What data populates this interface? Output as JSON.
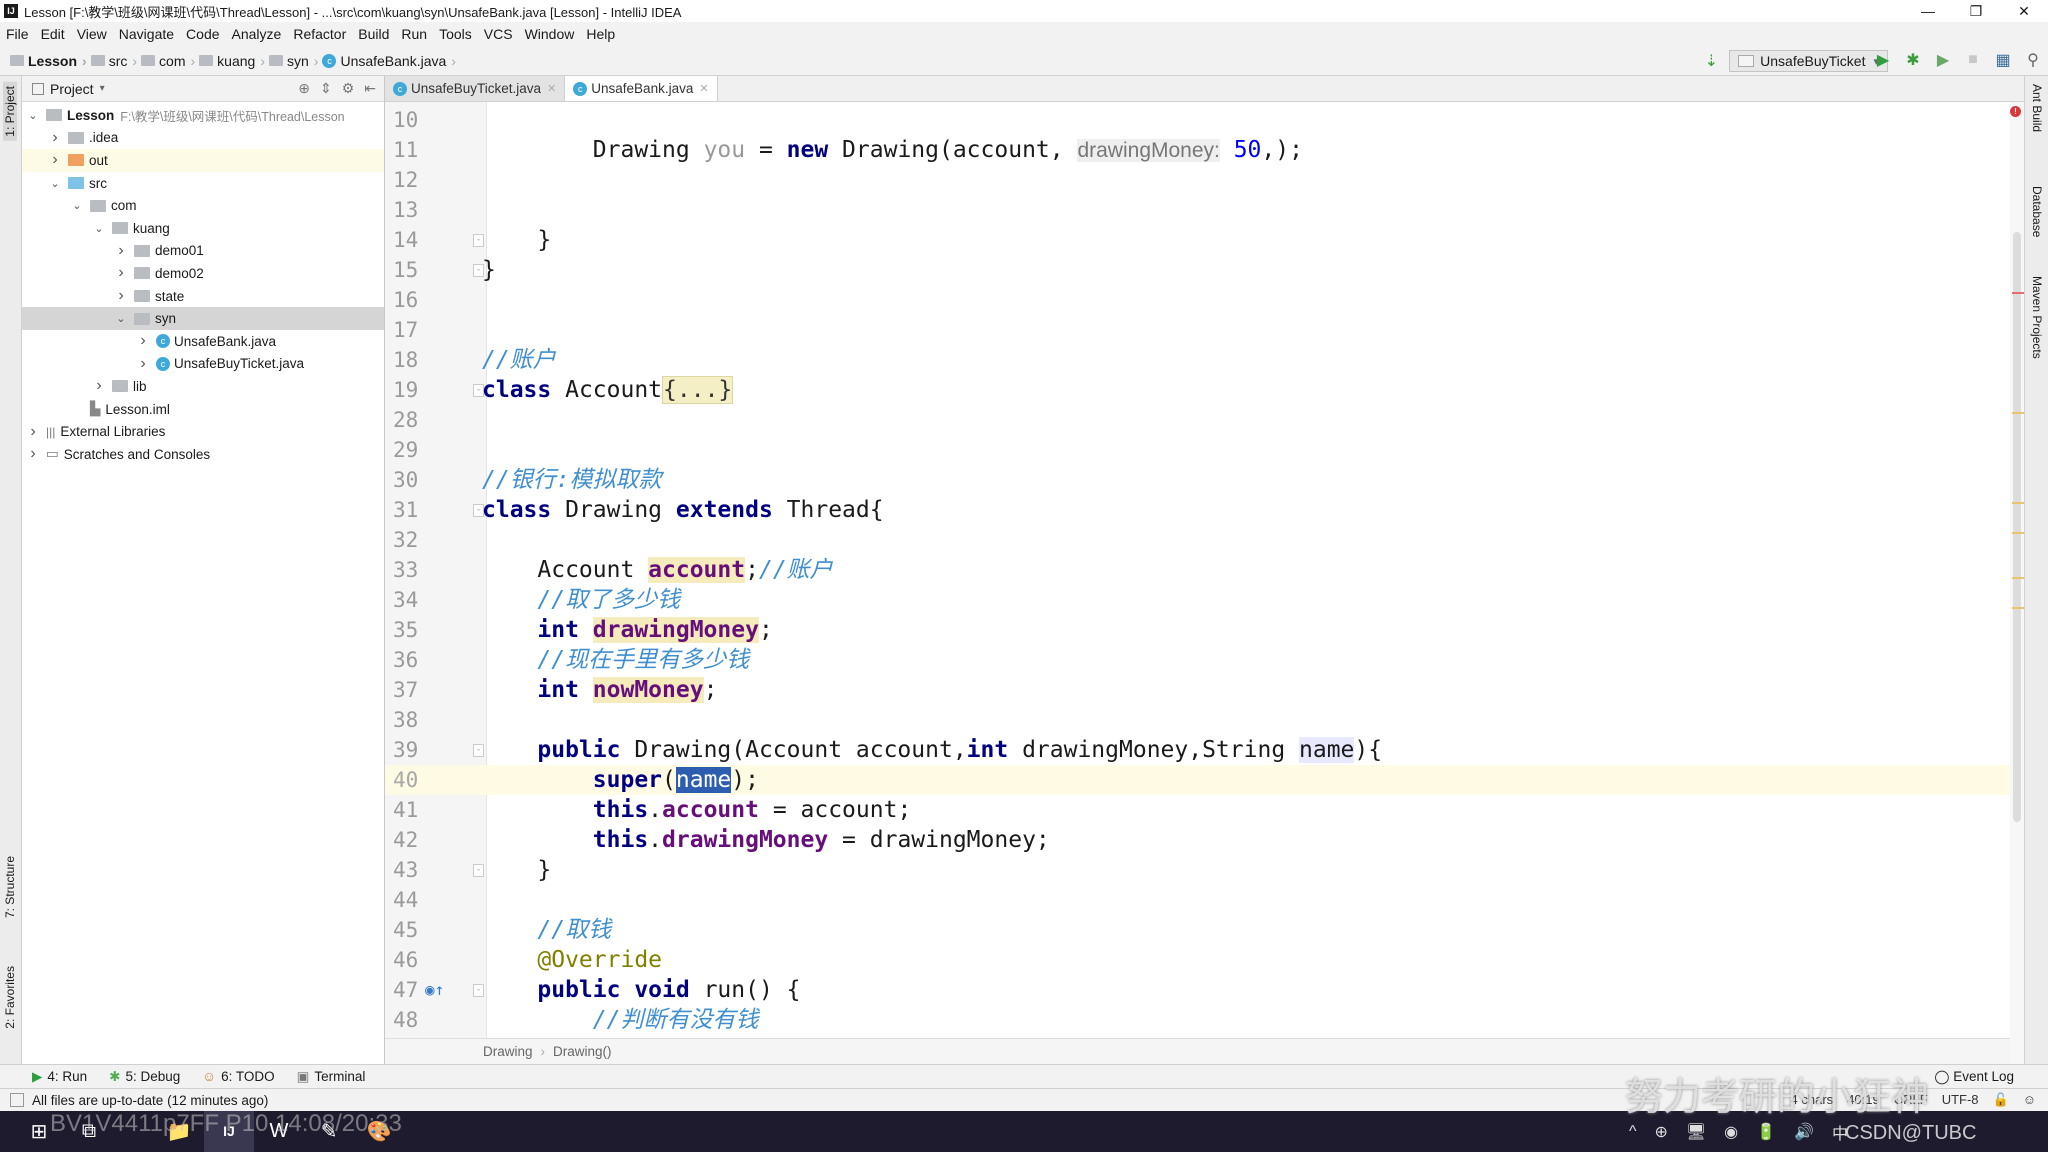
{
  "window": {
    "title": "Lesson [F:\\教学\\班级\\网课班\\代码\\Thread\\Lesson] - ...\\src\\com\\kuang\\syn\\UnsafeBank.java [Lesson] - IntelliJ IDEA",
    "logo": "IJ",
    "minimize": "—",
    "restore": "❐",
    "close": "✕"
  },
  "menu": [
    "File",
    "Edit",
    "View",
    "Navigate",
    "Code",
    "Analyze",
    "Refactor",
    "Build",
    "Run",
    "Tools",
    "VCS",
    "Window",
    "Help"
  ],
  "breadcrumb": [
    "Lesson",
    "src",
    "com",
    "kuang",
    "syn",
    "UnsafeBank.java"
  ],
  "toolbar": {
    "run_config": "UnsafeBuyTicket",
    "run_icon": "▶",
    "debug_icon": "✱",
    "coverage_icon": "▶",
    "stop_icon": "■",
    "structure_icon": "▦",
    "search_icon": "⚲",
    "sort_icon": "⇣"
  },
  "left_strip": {
    "project": "1: Project",
    "structure": "7: Structure",
    "favorites": "2: Favorites"
  },
  "right_strip": {
    "ant": "Ant Build",
    "database": "Database",
    "maven": "Maven Projects"
  },
  "project": {
    "header": "Project",
    "items": [
      {
        "label": "Lesson",
        "path": "F:\\教学\\班级\\网课班\\代码\\Thread\\Lesson",
        "depth": 0,
        "arrow": "open",
        "icon": "module",
        "bold": true
      },
      {
        "label": ".idea",
        "depth": 1,
        "arrow": "closed",
        "icon": "folder"
      },
      {
        "label": "out",
        "depth": 1,
        "arrow": "closed",
        "icon": "folder-out",
        "state": "hl"
      },
      {
        "label": "src",
        "depth": 1,
        "arrow": "open",
        "icon": "folder-src"
      },
      {
        "label": "com",
        "depth": 2,
        "arrow": "open",
        "icon": "folder"
      },
      {
        "label": "kuang",
        "depth": 3,
        "arrow": "open",
        "icon": "folder"
      },
      {
        "label": "demo01",
        "depth": 4,
        "arrow": "closed",
        "icon": "folder"
      },
      {
        "label": "demo02",
        "depth": 4,
        "arrow": "closed",
        "icon": "folder"
      },
      {
        "label": "state",
        "depth": 4,
        "arrow": "closed",
        "icon": "folder"
      },
      {
        "label": "syn",
        "depth": 4,
        "arrow": "open",
        "icon": "folder",
        "state": "sel"
      },
      {
        "label": "UnsafeBank.java",
        "depth": 5,
        "arrow": "closed",
        "icon": "class"
      },
      {
        "label": "UnsafeBuyTicket.java",
        "depth": 5,
        "arrow": "closed",
        "icon": "class"
      },
      {
        "label": "lib",
        "depth": 3,
        "arrow": "closed",
        "icon": "folder"
      },
      {
        "label": "Lesson.iml",
        "depth": 2,
        "arrow": "none",
        "icon": "file"
      },
      {
        "label": "External Libraries",
        "depth": 0,
        "arrow": "closed",
        "icon": "libs"
      },
      {
        "label": "Scratches and Consoles",
        "depth": 0,
        "arrow": "closed",
        "icon": "scratch"
      }
    ]
  },
  "tabs": [
    {
      "label": "UnsafeBuyTicket.java",
      "active": false
    },
    {
      "label": "UnsafeBank.java",
      "active": true
    }
  ],
  "code": [
    {
      "n": "10",
      "t": []
    },
    {
      "n": "11",
      "t": [
        [
          "p",
          "        Drawing "
        ],
        [
          "unused",
          "you"
        ],
        [
          "p",
          " = "
        ],
        [
          "kw",
          "new"
        ],
        [
          "p",
          " Drawing(account, "
        ],
        [
          "hint",
          "drawingMoney:"
        ],
        [
          "num",
          " 50"
        ],
        [
          "p",
          ",);"
        ]
      ]
    },
    {
      "n": "12",
      "t": []
    },
    {
      "n": "13",
      "t": []
    },
    {
      "n": "14",
      "t": [
        [
          "p",
          "    }"
        ]
      ],
      "fold": true
    },
    {
      "n": "15",
      "t": [
        [
          "p",
          "}"
        ]
      ],
      "fold": true
    },
    {
      "n": "16",
      "t": []
    },
    {
      "n": "17",
      "t": []
    },
    {
      "n": "18",
      "t": [
        [
          "com",
          "//账户"
        ]
      ]
    },
    {
      "n": "19",
      "t": [
        [
          "kw",
          "class"
        ],
        [
          "p",
          " Account"
        ],
        [
          "fold",
          "{...}"
        ]
      ],
      "fold": true
    },
    {
      "n": "28",
      "t": []
    },
    {
      "n": "29",
      "t": []
    },
    {
      "n": "30",
      "t": [
        [
          "com",
          "//银行:模拟取款"
        ]
      ]
    },
    {
      "n": "31",
      "t": [
        [
          "kw",
          "class"
        ],
        [
          "p",
          " Drawing "
        ],
        [
          "kw",
          "extends"
        ],
        [
          "p",
          " Thread{"
        ]
      ],
      "fold": true
    },
    {
      "n": "32",
      "t": []
    },
    {
      "n": "33",
      "t": [
        [
          "p",
          "    Account "
        ],
        [
          "fieldhl",
          "account"
        ],
        [
          "p",
          ";"
        ],
        [
          "com",
          "//账户"
        ]
      ]
    },
    {
      "n": "34",
      "t": [
        [
          "com",
          "    //取了多少钱"
        ]
      ]
    },
    {
      "n": "35",
      "t": [
        [
          "kw",
          "    int "
        ],
        [
          "fieldhl",
          "drawingMoney"
        ],
        [
          "p",
          ";"
        ]
      ]
    },
    {
      "n": "36",
      "t": [
        [
          "com",
          "    //现在手里有多少钱"
        ]
      ]
    },
    {
      "n": "37",
      "t": [
        [
          "kw",
          "    int "
        ],
        [
          "fieldhl",
          "nowMoney"
        ],
        [
          "p",
          ";"
        ]
      ]
    },
    {
      "n": "38",
      "t": []
    },
    {
      "n": "39",
      "t": [
        [
          "kw",
          "    public"
        ],
        [
          "p",
          " Drawing(Account account,"
        ],
        [
          "kw",
          "int"
        ],
        [
          "p",
          " drawingMoney,String "
        ],
        [
          "param",
          "name"
        ],
        [
          "p",
          "){"
        ]
      ],
      "fold": true
    },
    {
      "n": "40",
      "t": [
        [
          "kw",
          "        super"
        ],
        [
          "p",
          "("
        ],
        [
          "sel",
          "name"
        ],
        [
          "p",
          ");"
        ]
      ],
      "current": true
    },
    {
      "n": "41",
      "t": [
        [
          "kw",
          "        this"
        ],
        [
          "p",
          "."
        ],
        [
          "field",
          "account"
        ],
        [
          "p",
          " = account;"
        ]
      ]
    },
    {
      "n": "42",
      "t": [
        [
          "kw",
          "        this"
        ],
        [
          "p",
          "."
        ],
        [
          "field",
          "drawingMoney"
        ],
        [
          "p",
          " = drawingMoney;"
        ]
      ]
    },
    {
      "n": "43",
      "t": [
        [
          "p",
          "    }"
        ]
      ],
      "fold": true
    },
    {
      "n": "44",
      "t": []
    },
    {
      "n": "45",
      "t": [
        [
          "com",
          "    //取钱"
        ]
      ]
    },
    {
      "n": "46",
      "t": [
        [
          "ann",
          "    @Override"
        ]
      ]
    },
    {
      "n": "47",
      "t": [
        [
          "kw",
          "    public void"
        ],
        [
          "p",
          " run() {"
        ]
      ],
      "fold": true,
      "override": true
    },
    {
      "n": "48",
      "t": [
        [
          "com",
          "        //判断有没有钱"
        ]
      ]
    }
  ],
  "editor_breadcrumb": [
    "Drawing",
    "Drawing()"
  ],
  "tool_windows": [
    {
      "label": "4: Run",
      "icon": "▶",
      "color": "#2e9e3e"
    },
    {
      "label": "5: Debug",
      "icon": "✱",
      "color": "#4caf50"
    },
    {
      "label": "6: TODO",
      "icon": "☺",
      "color": "#c08030"
    },
    {
      "label": "Terminal",
      "icon": "▣",
      "color": "#777"
    }
  ],
  "event_log": "Event Log",
  "status": {
    "message": "All files are up-to-date (12 minutes ago)",
    "chars": "4 chars",
    "position": "40:19",
    "line_sep": "CRLF",
    "encoding": "UTF-8"
  },
  "taskbar": {
    "start": "⊞",
    "items": [
      "⧉",
      "📁",
      "IJ",
      "W",
      "✎",
      "🎨"
    ],
    "tray": [
      "^",
      "⊕",
      "🖥",
      "◉",
      "🔋",
      "🔊",
      "中"
    ]
  },
  "watermarks": {
    "video": "BV1V4411p7FF P10 14:08/20:33",
    "channel": "努力考研的小狂神",
    "csdn": "CSDN@TUBC"
  }
}
